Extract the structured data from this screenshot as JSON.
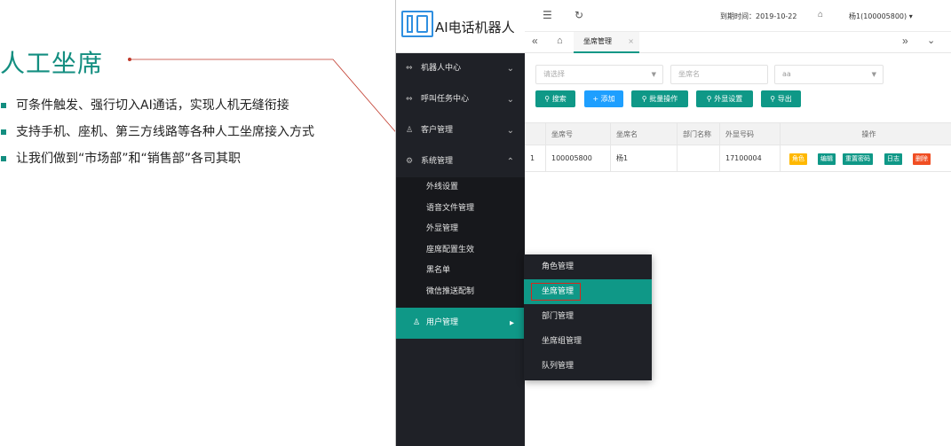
{
  "slide": {
    "title": "人工坐席",
    "bullets": [
      "可条件触发、强行切入AI通话，实现人机无缝衔接",
      "支持手机、座机、第三方线路等各种人工坐席接入方式",
      "让我们做到“市场部”和“销售部”各司其职"
    ]
  },
  "app": {
    "logo_text": "AI电话机器人",
    "topbar": {
      "expire_label": "到期时间：2019-10-22",
      "user_label": "杨1(100005800)"
    },
    "tab": {
      "label": "坐席管理",
      "close": "×"
    },
    "sidebar": {
      "items": [
        {
          "label": "机器人中心",
          "icon": "robot-icon"
        },
        {
          "label": "呼叫任务中心",
          "icon": "phone-icon"
        },
        {
          "label": "客户管理",
          "icon": "user-icon"
        },
        {
          "label": "系统管理",
          "icon": "gear-icon"
        }
      ],
      "sub_items": [
        "外线设置",
        "语音文件管理",
        "外显管理",
        "座席配置生效",
        "黑名单",
        "微信推送配制"
      ],
      "active": {
        "label": "用户管理",
        "icon": "user-icon"
      }
    },
    "filters": {
      "select1_placeholder": "请选择",
      "seat_name_placeholder": "坐席名",
      "select2_value": "aa"
    },
    "buttons": {
      "search": "搜索",
      "add": "添加",
      "batch": "批量操作",
      "display": "外显设置",
      "export": "导出"
    },
    "table": {
      "headers": [
        "坐席号",
        "坐席名",
        "部门名称",
        "外显号码",
        "操作"
      ],
      "rows": [
        {
          "index": "1",
          "seat_no": "100005800",
          "seat_name": "杨1",
          "dept": "",
          "display_no": "17100004"
        }
      ],
      "ops": [
        "角色",
        "编辑",
        "重置密码",
        "日志",
        "删除"
      ]
    },
    "popup_menu": [
      "角色管理",
      "坐席管理",
      "部门管理",
      "坐席组管理",
      "队列管理"
    ]
  },
  "colors": {
    "accent": "#0f9887",
    "sidebar": "#1f2127",
    "title": "#138e80",
    "danger": "#f04e23",
    "warn": "#ffb800"
  }
}
